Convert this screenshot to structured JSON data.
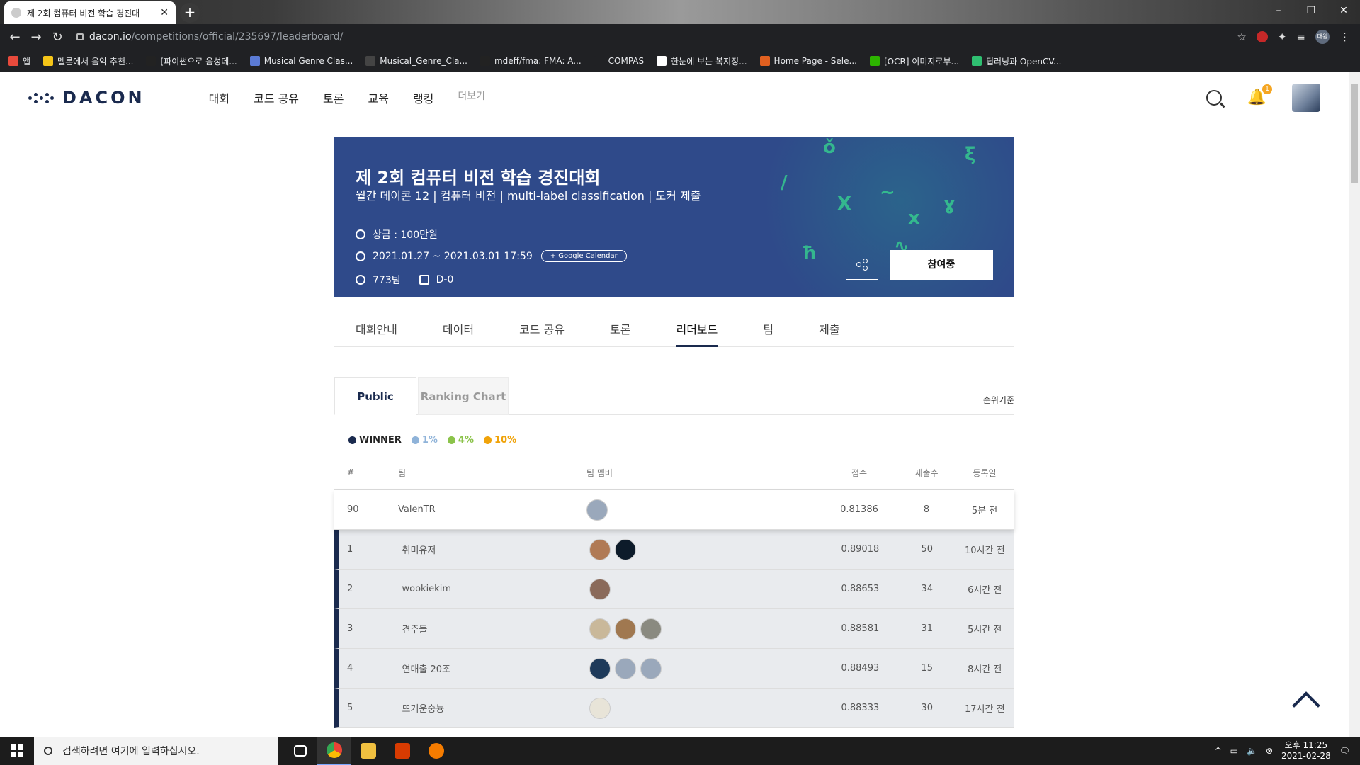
{
  "browser": {
    "tab_title": "제 2회 컴퓨터 비전 학습 경진대",
    "url_host": "dacon.io",
    "url_path": "/competitions/official/235697/leaderboard/",
    "profile_label": "대원",
    "bookmarks": [
      {
        "label": "앱",
        "color": "#e84a3c"
      },
      {
        "label": "멜론에서 음악 추천...",
        "color": "#f5c518"
      },
      {
        "label": "[파이썬으로 음성데...",
        "color": "#222222"
      },
      {
        "label": "Musical Genre Clas...",
        "color": "#5b7bd5"
      },
      {
        "label": "Musical_Genre_Cla...",
        "color": "#444444"
      },
      {
        "label": "mdeff/fma: FMA: A...",
        "color": "#222222"
      },
      {
        "label": "COMPAS",
        "color": "#202124"
      },
      {
        "label": "한눈에 보는 복지정...",
        "color": "#ffffff"
      },
      {
        "label": "Home Page - Sele...",
        "color": "#e06020"
      },
      {
        "label": "[OCR] 이미지로부...",
        "color": "#2db400"
      },
      {
        "label": "딥러닝과 OpenCV...",
        "color": "#2fbf71"
      }
    ]
  },
  "header": {
    "logo": "DACON",
    "nav": [
      "대회",
      "코드 공유",
      "토론",
      "교육",
      "랭킹"
    ],
    "more": "더보기",
    "notification_count": "1"
  },
  "banner": {
    "title": "제 2회 컴퓨터 비전 학습 경진대회",
    "subtitle": "월간 데이콘 12 | 컴퓨터 비전 | multi-label classification | 도커 제출",
    "prize": "상금 : 100만원",
    "period": "2021.01.27 ~ 2021.03.01 17:59",
    "gcal": "+ Google Calendar",
    "teams": "773팀",
    "dday": "D-0",
    "join_label": "참여중"
  },
  "subtabs": [
    "대회안내",
    "데이터",
    "코드 공유",
    "토론",
    "리더보드",
    "팀",
    "제출"
  ],
  "board": {
    "tab_public": "Public",
    "tab_chart": "Ranking Chart",
    "criteria": "순위기준",
    "legend": [
      {
        "label": "WINNER",
        "color": "#1a2a4e"
      },
      {
        "label": "1%",
        "color": "#8fb3d9"
      },
      {
        "label": "4%",
        "color": "#8bc34a"
      },
      {
        "label": "10%",
        "color": "#f0a30a"
      }
    ],
    "columns": [
      "#",
      "팀",
      "팀 멤버",
      "점수",
      "제출수",
      "등록일"
    ],
    "my_row": {
      "rank": "90",
      "team": "ValenTR",
      "score": "0.81386",
      "subs": "8",
      "date": "5분 전",
      "members": [
        "#9aa8bb"
      ]
    },
    "rows": [
      {
        "rank": "1",
        "team": "취미유저",
        "score": "0.89018",
        "subs": "50",
        "date": "10시간 전",
        "members": [
          "#b07a55",
          "#0d1b2a"
        ]
      },
      {
        "rank": "2",
        "team": "wookiekim",
        "score": "0.88653",
        "subs": "34",
        "date": "6시간 전",
        "members": [
          "#8a6a5a"
        ]
      },
      {
        "rank": "3",
        "team": "견주들",
        "score": "0.88581",
        "subs": "31",
        "date": "5시간 전",
        "members": [
          "#c9b89a",
          "#a07850",
          "#8a8a80"
        ]
      },
      {
        "rank": "4",
        "team": "연매출 20조",
        "score": "0.88493",
        "subs": "15",
        "date": "8시간 전",
        "members": [
          "#1e3a5a",
          "#9aa8bb",
          "#9aa8bb"
        ]
      },
      {
        "rank": "5",
        "team": "뜨거운숭늉",
        "score": "0.88333",
        "subs": "30",
        "date": "17시간 전",
        "members": [
          "#e8e4d8"
        ]
      }
    ]
  },
  "taskbar": {
    "search_placeholder": "검색하려면 여기에 입력하십시오.",
    "time": "오후 11:25",
    "date": "2021-02-28"
  }
}
